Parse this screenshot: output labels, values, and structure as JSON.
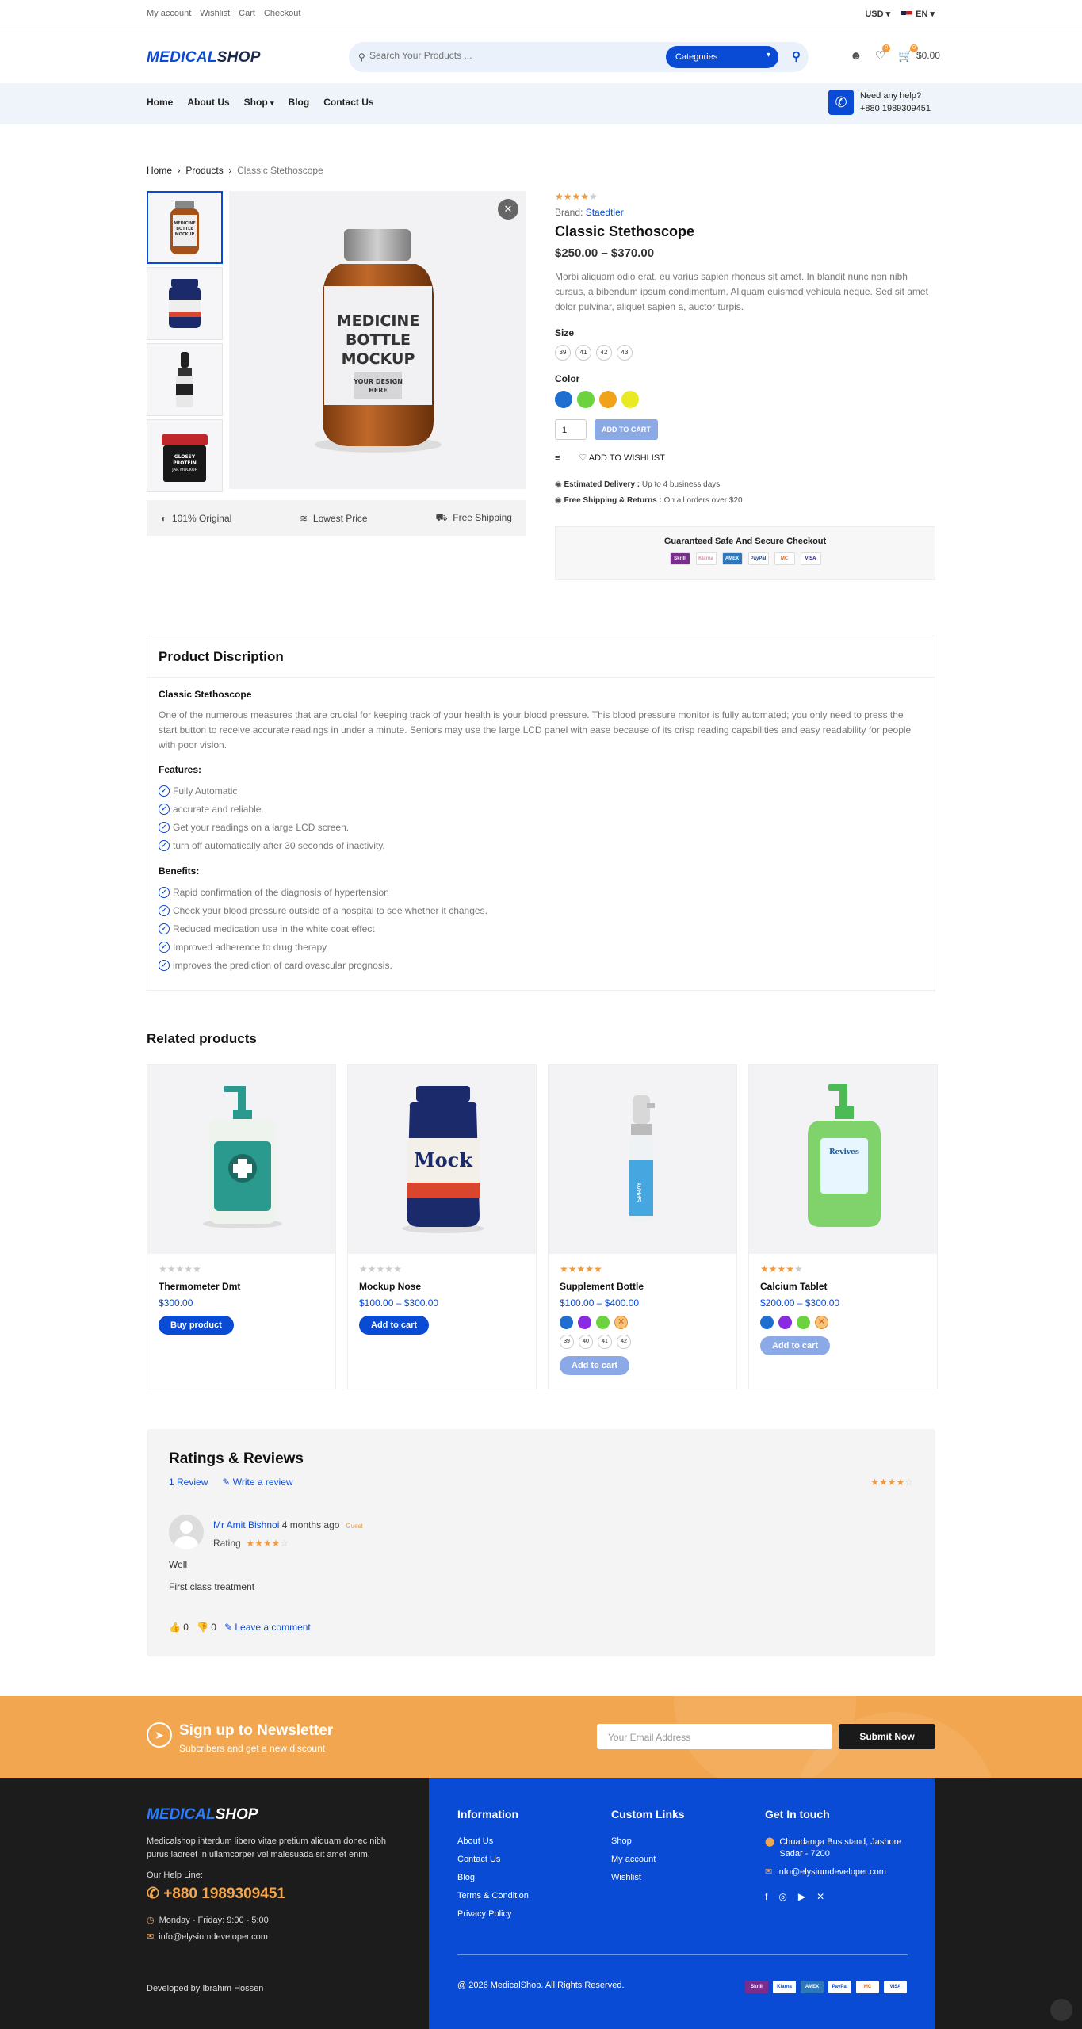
{
  "topbar": {
    "links": [
      "My account",
      "Wishlist",
      "Cart",
      "Checkout"
    ],
    "currency": "USD",
    "language": "EN"
  },
  "header": {
    "logo_a": "MEDICAL",
    "logo_b": "SHOP",
    "search_placeholder": "Search Your Products ...",
    "categories": "Categories",
    "wishlist_count": "0",
    "cart_count": "0",
    "cart_total": "$0.00"
  },
  "nav": {
    "items": [
      "Home",
      "About Us",
      "Shop",
      "Blog",
      "Contact Us"
    ],
    "help_title": "Need any help?",
    "help_phone": "+880 1989309451"
  },
  "breadcrumb": [
    "Home",
    "Products",
    "Classic Stethoscope"
  ],
  "gallery": {
    "main_label": [
      "MEDICINE",
      "BOTTLE",
      "MOCKUP"
    ],
    "main_design": [
      "YOUR DESIGN",
      "HERE"
    ],
    "thumb_labels": [
      "MEDICINE BOTTLE MOCKUP",
      "",
      "",
      "GLOSSY PROTEIN JAR MOCKUP"
    ]
  },
  "features": [
    "101% Original",
    "Lowest Price",
    "Free Shipping"
  ],
  "product": {
    "rating": 4,
    "brand_label": "Brand:",
    "brand": "Staedtler",
    "title": "Classic Stethoscope",
    "price": "$250.00 – $370.00",
    "description": "Morbi aliquam odio erat, eu varius sapien rhoncus sit amet. In blandit nunc non nibh cursus, a bibendum ipsum condimentum. Aliquam euismod vehicula neque. Sed sit amet dolor pulvinar, aliquet sapien a, auctor turpis.",
    "size_label": "Size",
    "sizes": [
      "39",
      "41",
      "42",
      "43"
    ],
    "color_label": "Color",
    "colors": [
      "#1f6fd1",
      "#6cd23e",
      "#f0a21a",
      "#eaea24"
    ],
    "qty": "1",
    "add_to_cart": "ADD TO CART",
    "add_to_wishlist": "ADD TO WISHLIST",
    "delivery_label": "Estimated Delivery :",
    "delivery_value": "Up to 4 business days",
    "shipping_label": "Free Shipping & Returns :",
    "shipping_value": "On all orders over $20",
    "secure_title": "Guaranteed Safe And Secure Checkout",
    "payments": [
      "Skrill",
      "Klarna",
      "AMEX",
      "PayPal",
      "MC",
      "VISA"
    ]
  },
  "description": {
    "heading": "Product Discription",
    "title": "Classic Stethoscope",
    "text": "One of the numerous measures that are crucial for keeping track of your health is your blood pressure. This blood pressure monitor is fully automated; you only need to press the start button to receive accurate readings in under a minute. Seniors may use the large LCD panel with ease because of its crisp reading capabilities and easy readability for people with poor vision.",
    "features_label": "Features:",
    "features": [
      "Fully Automatic",
      "accurate and reliable.",
      "Get your readings on a large LCD screen.",
      "turn off automatically after 30 seconds of inactivity."
    ],
    "benefits_label": "Benefits:",
    "benefits": [
      "Rapid confirmation of the diagnosis of hypertension",
      "Check your blood pressure outside of a hospital to see whether it changes.",
      "Reduced medication use in the white coat effect",
      "Improved adherence to drug therapy",
      "improves the prediction of cardiovascular prognosis."
    ]
  },
  "related": {
    "title": "Related products",
    "products": [
      {
        "name": "Thermometer Dmt",
        "price": "$300.00",
        "button": "Buy product",
        "rating": 0
      },
      {
        "name": "Mockup Nose",
        "price": "$100.00 – $300.00",
        "button": "Add to cart",
        "rating": 0
      },
      {
        "name": "Supplement Bottle",
        "price": "$100.00 – $400.00",
        "button": "Add to cart",
        "rating": 5,
        "sizes": [
          "39",
          "40",
          "41",
          "42"
        ]
      },
      {
        "name": "Calcium Tablet",
        "price": "$200.00 – $300.00",
        "button": "Add to cart",
        "rating": 4
      }
    ]
  },
  "reviews": {
    "title": "Ratings & Reviews",
    "count": "1 Review",
    "write": "Write a review",
    "reviewer": "Mr Amit Bishnoi",
    "time": "4 months ago",
    "tag": "Guest",
    "rating_label": "Rating",
    "line1": "Well",
    "line2": "First class treatment",
    "likes": "0",
    "dislikes": "0",
    "comment": "Leave a comment"
  },
  "newsletter": {
    "title": "Sign up to Newsletter",
    "subtitle": "Subcribers and get a new discount",
    "placeholder": "Your Email Address",
    "button": "Submit Now"
  },
  "footer": {
    "about": "Medicalshop interdum libero vitae pretium aliquam donec nibh purus laoreet in ullamcorper vel malesuada sit amet enim.",
    "help_label": "Our Help Line:",
    "phone": "+880 1989309451",
    "hours": "Monday - Friday: 9:00 - 5:00",
    "email": "info@elysiumdeveloper.com",
    "dev_prefix": "Developed by",
    "dev_name": "Ibrahim Hossen",
    "info_title": "Information",
    "info_links": [
      "About Us",
      "Contact Us",
      "Blog",
      "Terms & Condition",
      "Privacy Policy"
    ],
    "custom_title": "Custom Links",
    "custom_links": [
      "Shop",
      "My account",
      "Wishlist"
    ],
    "touch_title": "Get In touch",
    "address": "Chuadanga Bus stand, Jashore Sadar - 7200",
    "copyright": "@ 2026 MedicalShop. All Rights Reserved."
  }
}
